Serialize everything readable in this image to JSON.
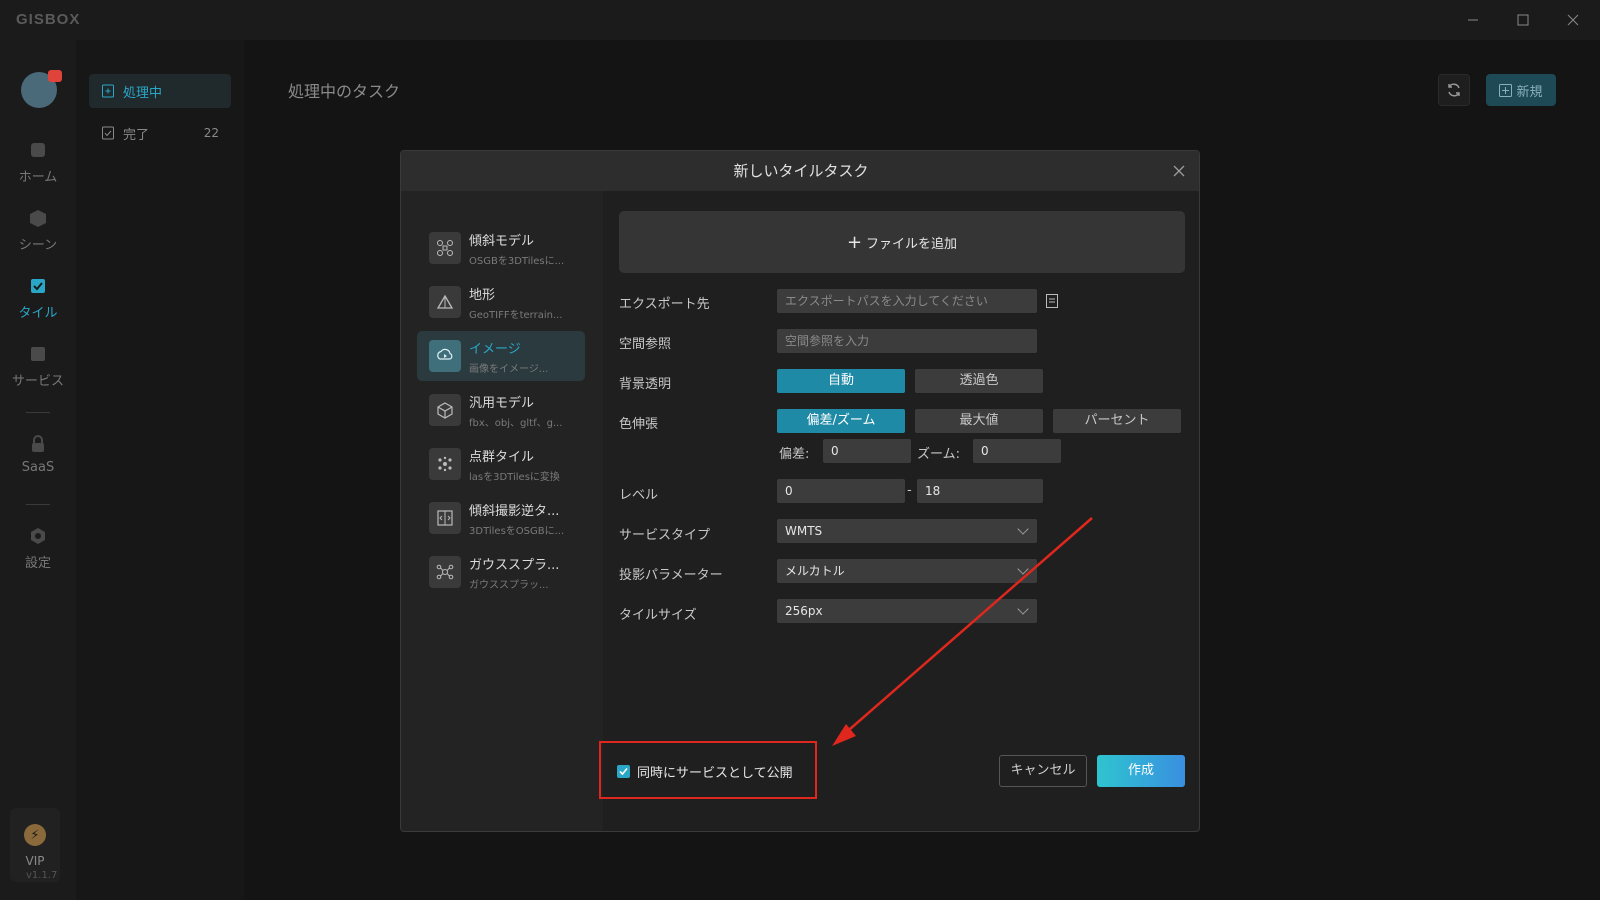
{
  "app": {
    "logo_text": "GISBOX",
    "version": "v1.1.7"
  },
  "rail": {
    "items": [
      {
        "label": "ホーム",
        "icon": "home-icon"
      },
      {
        "label": "シーン",
        "icon": "scene-icon"
      },
      {
        "label": "タイル",
        "icon": "tile-icon"
      },
      {
        "label": "サービス",
        "icon": "service-icon"
      },
      {
        "label": "SaaS",
        "icon": "lock-icon"
      },
      {
        "label": "設定",
        "icon": "settings-icon"
      }
    ],
    "vip_label": "VIP"
  },
  "sidebar": {
    "items": [
      {
        "label": "処理中",
        "count": ""
      },
      {
        "label": "完了",
        "count": "22"
      }
    ]
  },
  "main": {
    "title": "処理中のタスク",
    "new_button": "新規"
  },
  "modal": {
    "title": "新しいタイルタスク",
    "types": [
      {
        "title": "傾斜モデル",
        "subtitle": "OSGBを3DTilesに..."
      },
      {
        "title": "地形",
        "subtitle": "GeoTIFFをterrain..."
      },
      {
        "title": "イメージ",
        "subtitle": "画像をイメージ..."
      },
      {
        "title": "汎用モデル",
        "subtitle": "fbx、obj、gltf、g..."
      },
      {
        "title": "点群タイル",
        "subtitle": "lasを3DTilesに変換"
      },
      {
        "title": "傾斜撮影逆タ...",
        "subtitle": "3DTilesをOSGBに..."
      },
      {
        "title": "ガウススプラ...",
        "subtitle": "ガウススプラッ..."
      }
    ],
    "add_file": "ファイルを追加",
    "export_label": "エクスポート先",
    "export_placeholder": "エクスポートパスを入力してください",
    "srs_label": "空間参照",
    "srs_placeholder": "空間参照を入力",
    "bg_label": "背景透明",
    "bg_options": [
      "自動",
      "透過色"
    ],
    "stretch_label": "色伸張",
    "stretch_options": [
      "偏差/ズーム",
      "最大値",
      "パーセント"
    ],
    "deviation_label": "偏差:",
    "deviation_value": "0",
    "zoom_label": "ズーム:",
    "zoom_value": "0",
    "level_label": "レベル",
    "level_min": "0",
    "level_sep": "-",
    "level_max": "18",
    "service_type_label": "サービスタイプ",
    "service_type_value": "WMTS",
    "projection_label": "投影パラメーター",
    "projection_value": "メルカトル",
    "tile_size_label": "タイルサイズ",
    "tile_size_value": "256px",
    "publish_label": "同時にサービスとして公開",
    "cancel": "キャンセル",
    "create": "作成"
  },
  "colors": {
    "accent": "#2aa7c7",
    "annotation": "#e0271d"
  }
}
